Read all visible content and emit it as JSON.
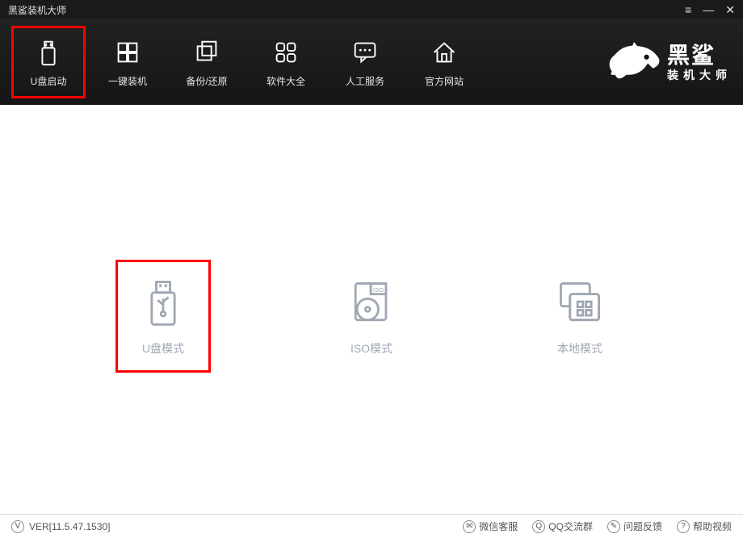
{
  "app": {
    "title": "黑鲨装机大师",
    "brand_line1": "黑鲨",
    "brand_line2": "装机大师"
  },
  "nav": [
    {
      "label": "U盘启动",
      "icon": "usb-icon",
      "selected": true
    },
    {
      "label": "一键装机",
      "icon": "windows-icon",
      "selected": false
    },
    {
      "label": "备份/还原",
      "icon": "copy-icon",
      "selected": false
    },
    {
      "label": "软件大全",
      "icon": "grid-icon",
      "selected": false
    },
    {
      "label": "人工服务",
      "icon": "chat-icon",
      "selected": false
    },
    {
      "label": "官方网站",
      "icon": "home-icon",
      "selected": false
    }
  ],
  "modes": [
    {
      "label": "U盘模式",
      "icon": "usb-mode-icon",
      "selected": true
    },
    {
      "label": "ISO模式",
      "icon": "iso-mode-icon",
      "selected": false
    },
    {
      "label": "本地模式",
      "icon": "local-mode-icon",
      "selected": false
    }
  ],
  "status": {
    "version_badge": "V",
    "version": "VER[11.5.47.1530]",
    "links": [
      {
        "label": "微信客服",
        "icon": "wechat-icon"
      },
      {
        "label": "QQ交流群",
        "icon": "qq-icon"
      },
      {
        "label": "问题反馈",
        "icon": "feedback-icon"
      },
      {
        "label": "帮助视频",
        "icon": "help-icon"
      }
    ]
  }
}
